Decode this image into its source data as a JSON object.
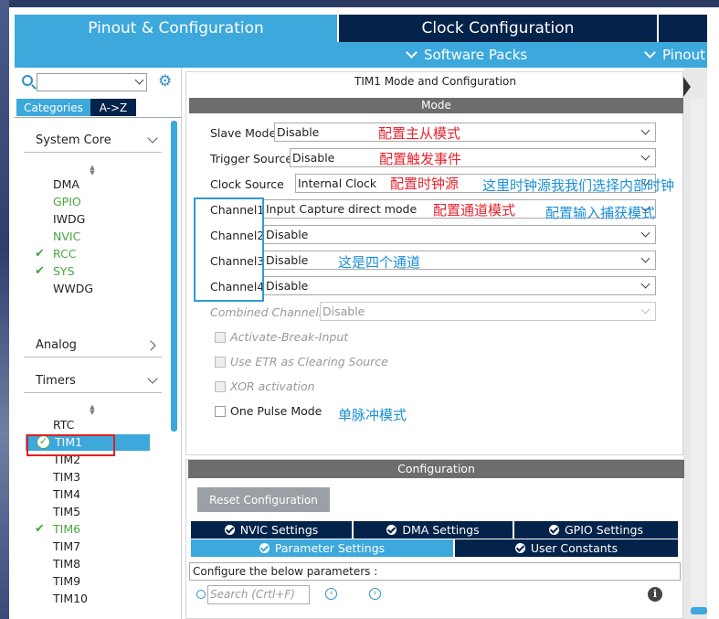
{
  "header": {
    "tabs": [
      {
        "label": "Pinout & Configuration"
      },
      {
        "label": "Clock Configuration"
      }
    ],
    "subbar": [
      {
        "label": "Software Packs"
      },
      {
        "label": "Pinout"
      }
    ]
  },
  "left": {
    "search": {
      "value": ""
    },
    "buttons": {
      "categories": "Categories",
      "az": "A->Z"
    },
    "sections": {
      "system_core": "System Core",
      "analog": "Analog",
      "timers": "Timers"
    },
    "system_core_items": [
      {
        "label": "DMA",
        "state": "normal"
      },
      {
        "label": "GPIO",
        "state": "green"
      },
      {
        "label": "IWDG",
        "state": "normal"
      },
      {
        "label": "NVIC",
        "state": "green"
      },
      {
        "label": "RCC",
        "state": "checked"
      },
      {
        "label": "SYS",
        "state": "checked"
      },
      {
        "label": "WWDG",
        "state": "normal"
      }
    ],
    "timer_items": [
      {
        "label": "RTC",
        "state": "normal"
      },
      {
        "label": "TIM1",
        "state": "selected"
      },
      {
        "label": "TIM2",
        "state": "normal"
      },
      {
        "label": "TIM3",
        "state": "normal"
      },
      {
        "label": "TIM4",
        "state": "normal"
      },
      {
        "label": "TIM5",
        "state": "normal"
      },
      {
        "label": "TIM6",
        "state": "checked"
      },
      {
        "label": "TIM7",
        "state": "normal"
      },
      {
        "label": "TIM8",
        "state": "normal"
      },
      {
        "label": "TIM9",
        "state": "normal"
      },
      {
        "label": "TIM10",
        "state": "normal"
      }
    ]
  },
  "mode": {
    "title": "TIM1 Mode and Configuration",
    "bar": "Mode",
    "rows": {
      "slave_mode": {
        "label": "Slave Mode",
        "value": "Disable"
      },
      "trigger_source": {
        "label": "Trigger Source",
        "value": "Disable"
      },
      "clock_source": {
        "label": "Clock Source",
        "value": "Internal Clock"
      },
      "channel1": {
        "label": "Channel1",
        "value": "Input Capture direct mode"
      },
      "channel2": {
        "label": "Channel2",
        "value": "Disable"
      },
      "channel3": {
        "label": "Channel3",
        "value": "Disable"
      },
      "channel4": {
        "label": "Channel4",
        "value": "Disable"
      },
      "combined_channels": {
        "label": "Combined Channels",
        "value": "Disable"
      }
    },
    "checkboxes": {
      "activate_break": "Activate-Break-Input",
      "use_etr": "Use ETR as Clearing Source",
      "xor": "XOR activation",
      "one_pulse": "One Pulse Mode"
    }
  },
  "annotations": {
    "slave": "配置主从模式",
    "trigger": "配置触发事件",
    "clock": "配置时钟源",
    "clock_note": "这里时钟源我我们选择内部时钟",
    "channel": "配置通道模式",
    "capture": "配置输入捕获模式",
    "four_channels": "这是四个通道",
    "pulse": "单脉冲模式"
  },
  "config": {
    "bar": "Configuration",
    "reset_label": "Reset Configuration",
    "tabs_row1": [
      {
        "label": "NVIC Settings"
      },
      {
        "label": "DMA Settings"
      },
      {
        "label": "GPIO Settings"
      }
    ],
    "tabs_row2": [
      {
        "label": "Parameter Settings"
      },
      {
        "label": "User Constants"
      }
    ],
    "hint": "Configure the below parameters :",
    "search_placeholder": "Search (Crtl+F)"
  },
  "colors": {
    "accent": "#3ca8dc",
    "navy": "#03234b",
    "mode_bar": "#6d6d6d",
    "annotation_red": "#e8232c",
    "annotation_blue": "#1a8fd8",
    "enabled_green": "#4aa63f"
  },
  "icons": {
    "search": "search-icon",
    "settings": "gear-icon",
    "info": "info-icon"
  }
}
